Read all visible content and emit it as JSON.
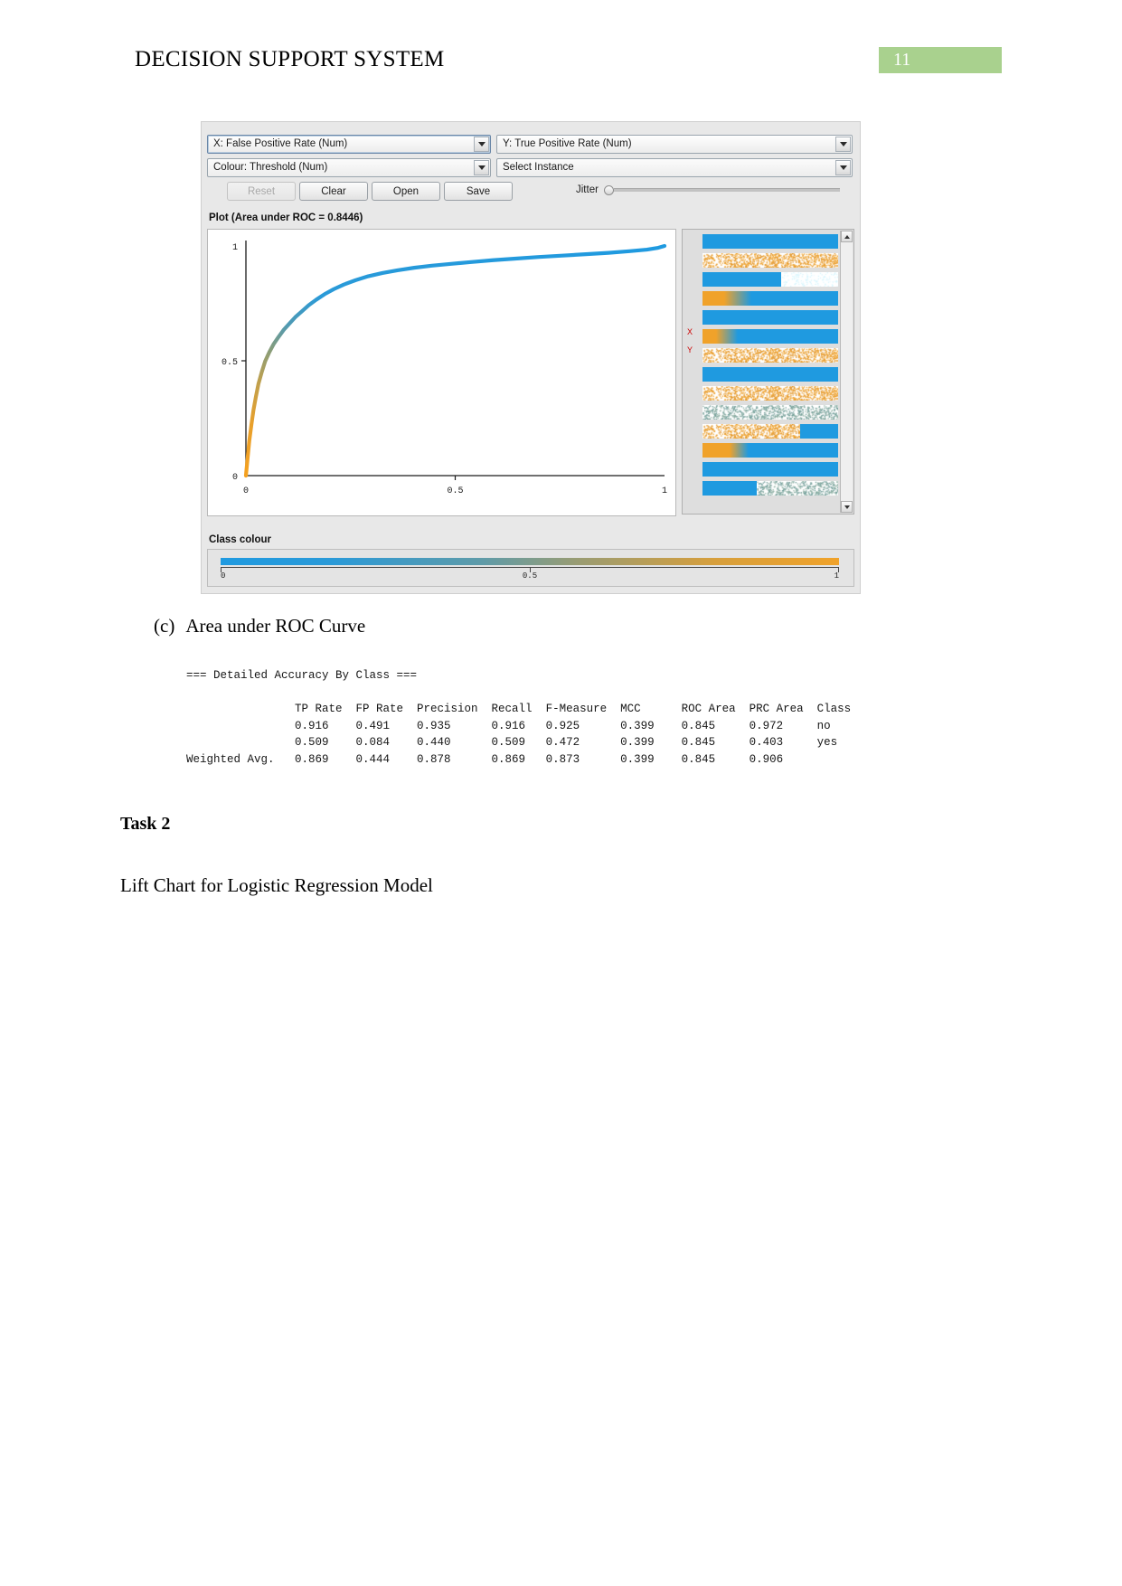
{
  "header": {
    "document_title": "DECISION SUPPORT SYSTEM",
    "page_number": "11",
    "badge_color": "#a9d18e"
  },
  "weka": {
    "x_axis_combo": "X: False Positive Rate (Num)",
    "y_axis_combo": "Y: True Positive Rate (Num)",
    "colour_combo": "Colour: Threshold (Num)",
    "select_instance_combo": "Select Instance",
    "buttons": [
      {
        "label": "Reset",
        "enabled": false
      },
      {
        "label": "Clear",
        "enabled": true
      },
      {
        "label": "Open",
        "enabled": true
      },
      {
        "label": "Save",
        "enabled": true
      }
    ],
    "jitter_label": "Jitter",
    "plot_title": "Plot (Area under ROC = 0.8446)",
    "attribute_markers": {
      "x": "X",
      "y": "Y"
    },
    "class_colour_label": "Class colour",
    "class_colour_ticks": [
      "0",
      "0.5",
      "1"
    ],
    "class_colour_start": "#1f9ae0",
    "class_colour_end": "#f0a22a"
  },
  "chart_data": {
    "type": "line",
    "title": "Plot (Area under ROC = 0.8446)",
    "xlabel": "False Positive Rate",
    "ylabel": "True Positive Rate",
    "xlim": [
      0,
      1
    ],
    "ylim": [
      0,
      1
    ],
    "grid": false,
    "legend": "none",
    "xticks": [
      "0",
      "0.5",
      "1"
    ],
    "yticks": [
      "0",
      "0.5",
      "1"
    ],
    "auc": 0.8446,
    "colormap": {
      "low": "#f0a22a",
      "high": "#1f9ae0",
      "meaning": "Threshold"
    },
    "series": [
      {
        "name": "ROC curve",
        "x": [
          0.0,
          0.004,
          0.008,
          0.013,
          0.018,
          0.024,
          0.03,
          0.038,
          0.046,
          0.056,
          0.066,
          0.078,
          0.09,
          0.104,
          0.118,
          0.134,
          0.15,
          0.168,
          0.188,
          0.21,
          0.234,
          0.262,
          0.292,
          0.326,
          0.362,
          0.402,
          0.444,
          0.49,
          0.538,
          0.59,
          0.644,
          0.7,
          0.756,
          0.812,
          0.866,
          0.916,
          0.958,
          0.985,
          1.0
        ],
        "y": [
          0.0,
          0.075,
          0.15,
          0.22,
          0.285,
          0.345,
          0.4,
          0.452,
          0.498,
          0.538,
          0.572,
          0.604,
          0.634,
          0.662,
          0.69,
          0.716,
          0.742,
          0.766,
          0.79,
          0.812,
          0.832,
          0.851,
          0.868,
          0.882,
          0.894,
          0.905,
          0.914,
          0.922,
          0.93,
          0.938,
          0.945,
          0.952,
          0.958,
          0.964,
          0.97,
          0.977,
          0.984,
          0.992,
          1.0
        ]
      }
    ]
  },
  "caption": {
    "number": "(c)",
    "text": "Area under ROC Curve"
  },
  "accuracy": {
    "section_title": "=== Detailed Accuracy By Class ===",
    "columns": [
      "TP Rate",
      "FP Rate",
      "Precision",
      "Recall",
      "F-Measure",
      "MCC",
      "ROC Area",
      "PRC Area",
      "Class"
    ],
    "rows": [
      {
        "label": "",
        "values": [
          "0.916",
          "0.491",
          "0.935",
          "0.916",
          "0.925",
          "0.399",
          "0.845",
          "0.972",
          "no"
        ]
      },
      {
        "label": "",
        "values": [
          "0.509",
          "0.084",
          "0.440",
          "0.509",
          "0.472",
          "0.399",
          "0.845",
          "0.403",
          "yes"
        ]
      },
      {
        "label": "Weighted Avg.",
        "values": [
          "0.869",
          "0.444",
          "0.878",
          "0.869",
          "0.873",
          "0.399",
          "0.845",
          "0.906",
          ""
        ]
      }
    ],
    "rendered_lines": [
      "=== Detailed Accuracy By Class ===",
      "",
      "                TP Rate  FP Rate  Precision  Recall  F-Measure  MCC      ROC Area  PRC Area  Class",
      "                0.916    0.491    0.935      0.916   0.925      0.399    0.845     0.972     no",
      "                0.509    0.084    0.440      0.509   0.472      0.399    0.845     0.403     yes",
      "Weighted Avg.   0.869    0.444    0.878      0.869   0.873      0.399    0.845     0.906"
    ]
  },
  "body": {
    "task_heading": "Task 2",
    "paragraph": "Lift Chart for Logistic Regression Model"
  }
}
